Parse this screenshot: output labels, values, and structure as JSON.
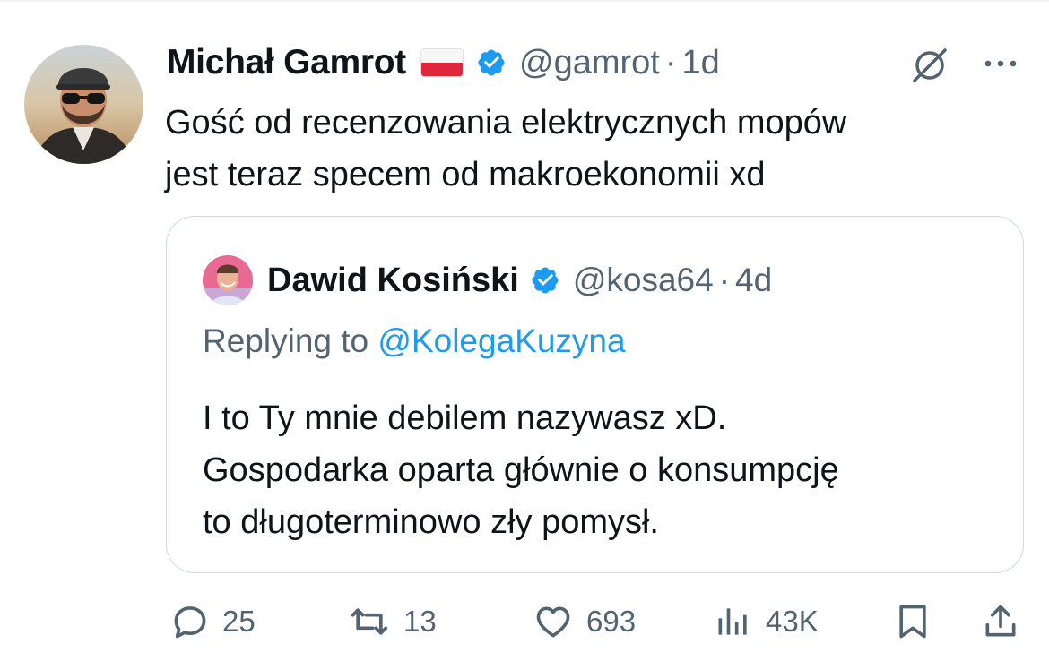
{
  "tweet": {
    "author_name": "Michał Gamrot",
    "handle": "@gamrot",
    "separator": "·",
    "time": "1d",
    "text": "Gość od recenzowania elektrycznych mopów\njest teraz specem od makroekonomii xd"
  },
  "quote": {
    "author_name": "Dawid Kosiński",
    "handle": "@kosa64",
    "separator": "·",
    "time": "4d",
    "replying_prefix": "Replying to ",
    "replying_to": "@KolegaKuzyna",
    "text": "I to Ty mnie debilem nazywasz xD.\nGospodarka oparta głównie o konsumpcję\nto długoterminowo zły pomysł."
  },
  "actions": {
    "replies": "25",
    "reposts": "13",
    "likes": "693",
    "views": "43K"
  },
  "colors": {
    "text": "#0f1419",
    "secondary": "#536471",
    "accent": "#1d9bf0",
    "border": "#cfd9de"
  },
  "icons": {
    "flag": "poland-flag-icon",
    "verified": "verified-badge-icon",
    "grok": "grok-icon",
    "more": "more-icon",
    "reply": "reply-icon",
    "repost": "repost-icon",
    "like": "like-icon",
    "views": "views-icon",
    "bookmark": "bookmark-icon",
    "share": "share-icon"
  }
}
